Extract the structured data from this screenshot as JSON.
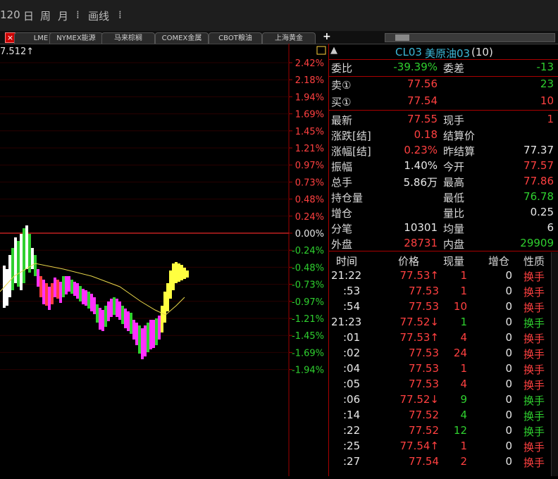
{
  "toolbar": {
    "period": "120",
    "day": "日",
    "week": "周",
    "month": "月",
    "sep": "⁞",
    "draw": "画线"
  },
  "tabs": [
    "LME",
    "NYMEX能源",
    "马来棕榈",
    "COMEX金属",
    "CBOT粮油",
    "上海黄金"
  ],
  "add_tab": "+",
  "close_label": "×",
  "chart": {
    "top_label": "7.512↑",
    "axis": [
      {
        "label": "2.42%",
        "cls": "red"
      },
      {
        "label": "2.18%",
        "cls": "red"
      },
      {
        "label": "1.94%",
        "cls": "red"
      },
      {
        "label": "1.69%",
        "cls": "red"
      },
      {
        "label": "1.45%",
        "cls": "red"
      },
      {
        "label": "1.21%",
        "cls": "red"
      },
      {
        "label": "0.97%",
        "cls": "red"
      },
      {
        "label": "0.73%",
        "cls": "red"
      },
      {
        "label": "0.48%",
        "cls": "red"
      },
      {
        "label": "0.24%",
        "cls": "red"
      },
      {
        "label": "0.00%",
        "cls": "white"
      },
      {
        "label": "-0.24%",
        "cls": "green"
      },
      {
        "label": "-0.48%",
        "cls": "green"
      },
      {
        "label": "-0.73%",
        "cls": "green"
      },
      {
        "label": "-0.97%",
        "cls": "green"
      },
      {
        "label": "-1.21%",
        "cls": "green"
      },
      {
        "label": "-1.45%",
        "cls": "green"
      },
      {
        "label": "-1.69%",
        "cls": "green"
      },
      {
        "label": "-1.94%",
        "cls": "green"
      }
    ]
  },
  "panel": {
    "code": "CL03",
    "name": "美原油03",
    "count": "(10)",
    "warn_icon": "▲",
    "rows": [
      {
        "l1": "委比",
        "v1": "-39.39%",
        "c1": "green",
        "l2": "委差",
        "v2": "-13",
        "c2": "green"
      },
      {
        "l1": "卖①",
        "v1": "77.56",
        "c1": "red",
        "l2": "",
        "v2": "23",
        "c2": "green"
      },
      {
        "l1": "买①",
        "v1": "77.54",
        "c1": "red",
        "l2": "",
        "v2": "10",
        "c2": "red"
      },
      {
        "l1": "最新",
        "v1": "77.55",
        "c1": "red",
        "l2": "现手",
        "v2": "1",
        "c2": "red",
        "l1c": "yellow"
      },
      {
        "l1": "涨跌[结]",
        "v1": "0.18",
        "c1": "red",
        "l2": "结算价",
        "v2": "",
        "c2": "white"
      },
      {
        "l1": "涨幅[结]",
        "v1": "0.23%",
        "c1": "red",
        "l2": "昨结算",
        "v2": "77.37",
        "c2": "white"
      },
      {
        "l1": "振幅",
        "v1": "1.40%",
        "c1": "white",
        "l2": "今开",
        "v2": "77.57",
        "c2": "red"
      },
      {
        "l1": "总手",
        "v1": "5.86万",
        "c1": "white",
        "l2": "最高",
        "v2": "77.86",
        "c2": "red"
      },
      {
        "l1": "持仓量",
        "v1": "",
        "c1": "white",
        "l2": "最低",
        "v2": "76.78",
        "c2": "green"
      },
      {
        "l1": "增仓",
        "v1": "",
        "c1": "white",
        "l2": "量比",
        "v2": "0.25",
        "c2": "white"
      },
      {
        "l1": "分笔",
        "v1": "10301",
        "c1": "white",
        "l2": "均量",
        "v2": "6",
        "c2": "white"
      },
      {
        "l1": "外盘",
        "v1": "28731",
        "c1": "red",
        "l2": "内盘",
        "v2": "29909",
        "c2": "green"
      }
    ],
    "trade_headers": {
      "time": "时间",
      "price": "价格",
      "vol": "现量",
      "pos": "增仓",
      "type": "性质"
    },
    "trades": [
      {
        "time": "21:22",
        "price": "77.53↑",
        "pc": "red",
        "vol": "1",
        "vc": "red",
        "pos": "0",
        "type": "换手",
        "tc": "red"
      },
      {
        "time": ":53",
        "price": "77.53",
        "pc": "red",
        "vol": "1",
        "vc": "red",
        "pos": "0",
        "type": "换手",
        "tc": "red"
      },
      {
        "time": ":54",
        "price": "77.53",
        "pc": "red",
        "vol": "10",
        "vc": "red",
        "pos": "0",
        "type": "换手",
        "tc": "red"
      },
      {
        "time": "21:23",
        "price": "77.52↓",
        "pc": "red",
        "vol": "1",
        "vc": "green",
        "pos": "0",
        "type": "换手",
        "tc": "green"
      },
      {
        "time": ":01",
        "price": "77.53↑",
        "pc": "red",
        "vol": "4",
        "vc": "red",
        "pos": "0",
        "type": "换手",
        "tc": "red"
      },
      {
        "time": ":02",
        "price": "77.53",
        "pc": "red",
        "vol": "24",
        "vc": "red",
        "pos": "0",
        "type": "换手",
        "tc": "red"
      },
      {
        "time": ":04",
        "price": "77.53",
        "pc": "red",
        "vol": "1",
        "vc": "red",
        "pos": "0",
        "type": "换手",
        "tc": "red"
      },
      {
        "time": ":05",
        "price": "77.53",
        "pc": "red",
        "vol": "4",
        "vc": "red",
        "pos": "0",
        "type": "换手",
        "tc": "red"
      },
      {
        "time": ":06",
        "price": "77.52↓",
        "pc": "red",
        "vol": "9",
        "vc": "green",
        "pos": "0",
        "type": "换手",
        "tc": "green"
      },
      {
        "time": ":14",
        "price": "77.52",
        "pc": "red",
        "vol": "4",
        "vc": "green",
        "pos": "0",
        "type": "换手",
        "tc": "green"
      },
      {
        "time": ":22",
        "price": "77.52",
        "pc": "red",
        "vol": "12",
        "vc": "green",
        "pos": "0",
        "type": "换手",
        "tc": "green"
      },
      {
        "time": ":25",
        "price": "77.54↑",
        "pc": "red",
        "vol": "1",
        "vc": "red",
        "pos": "0",
        "type": "换手",
        "tc": "red"
      },
      {
        "time": ":27",
        "price": "77.54",
        "pc": "red",
        "vol": "2",
        "vc": "red",
        "pos": "0",
        "type": "换手",
        "tc": "red"
      }
    ]
  },
  "colors": {
    "up": "#ff4040",
    "down": "#2fd02f",
    "accent": "#3cb8d8",
    "grid": "#a00000"
  }
}
